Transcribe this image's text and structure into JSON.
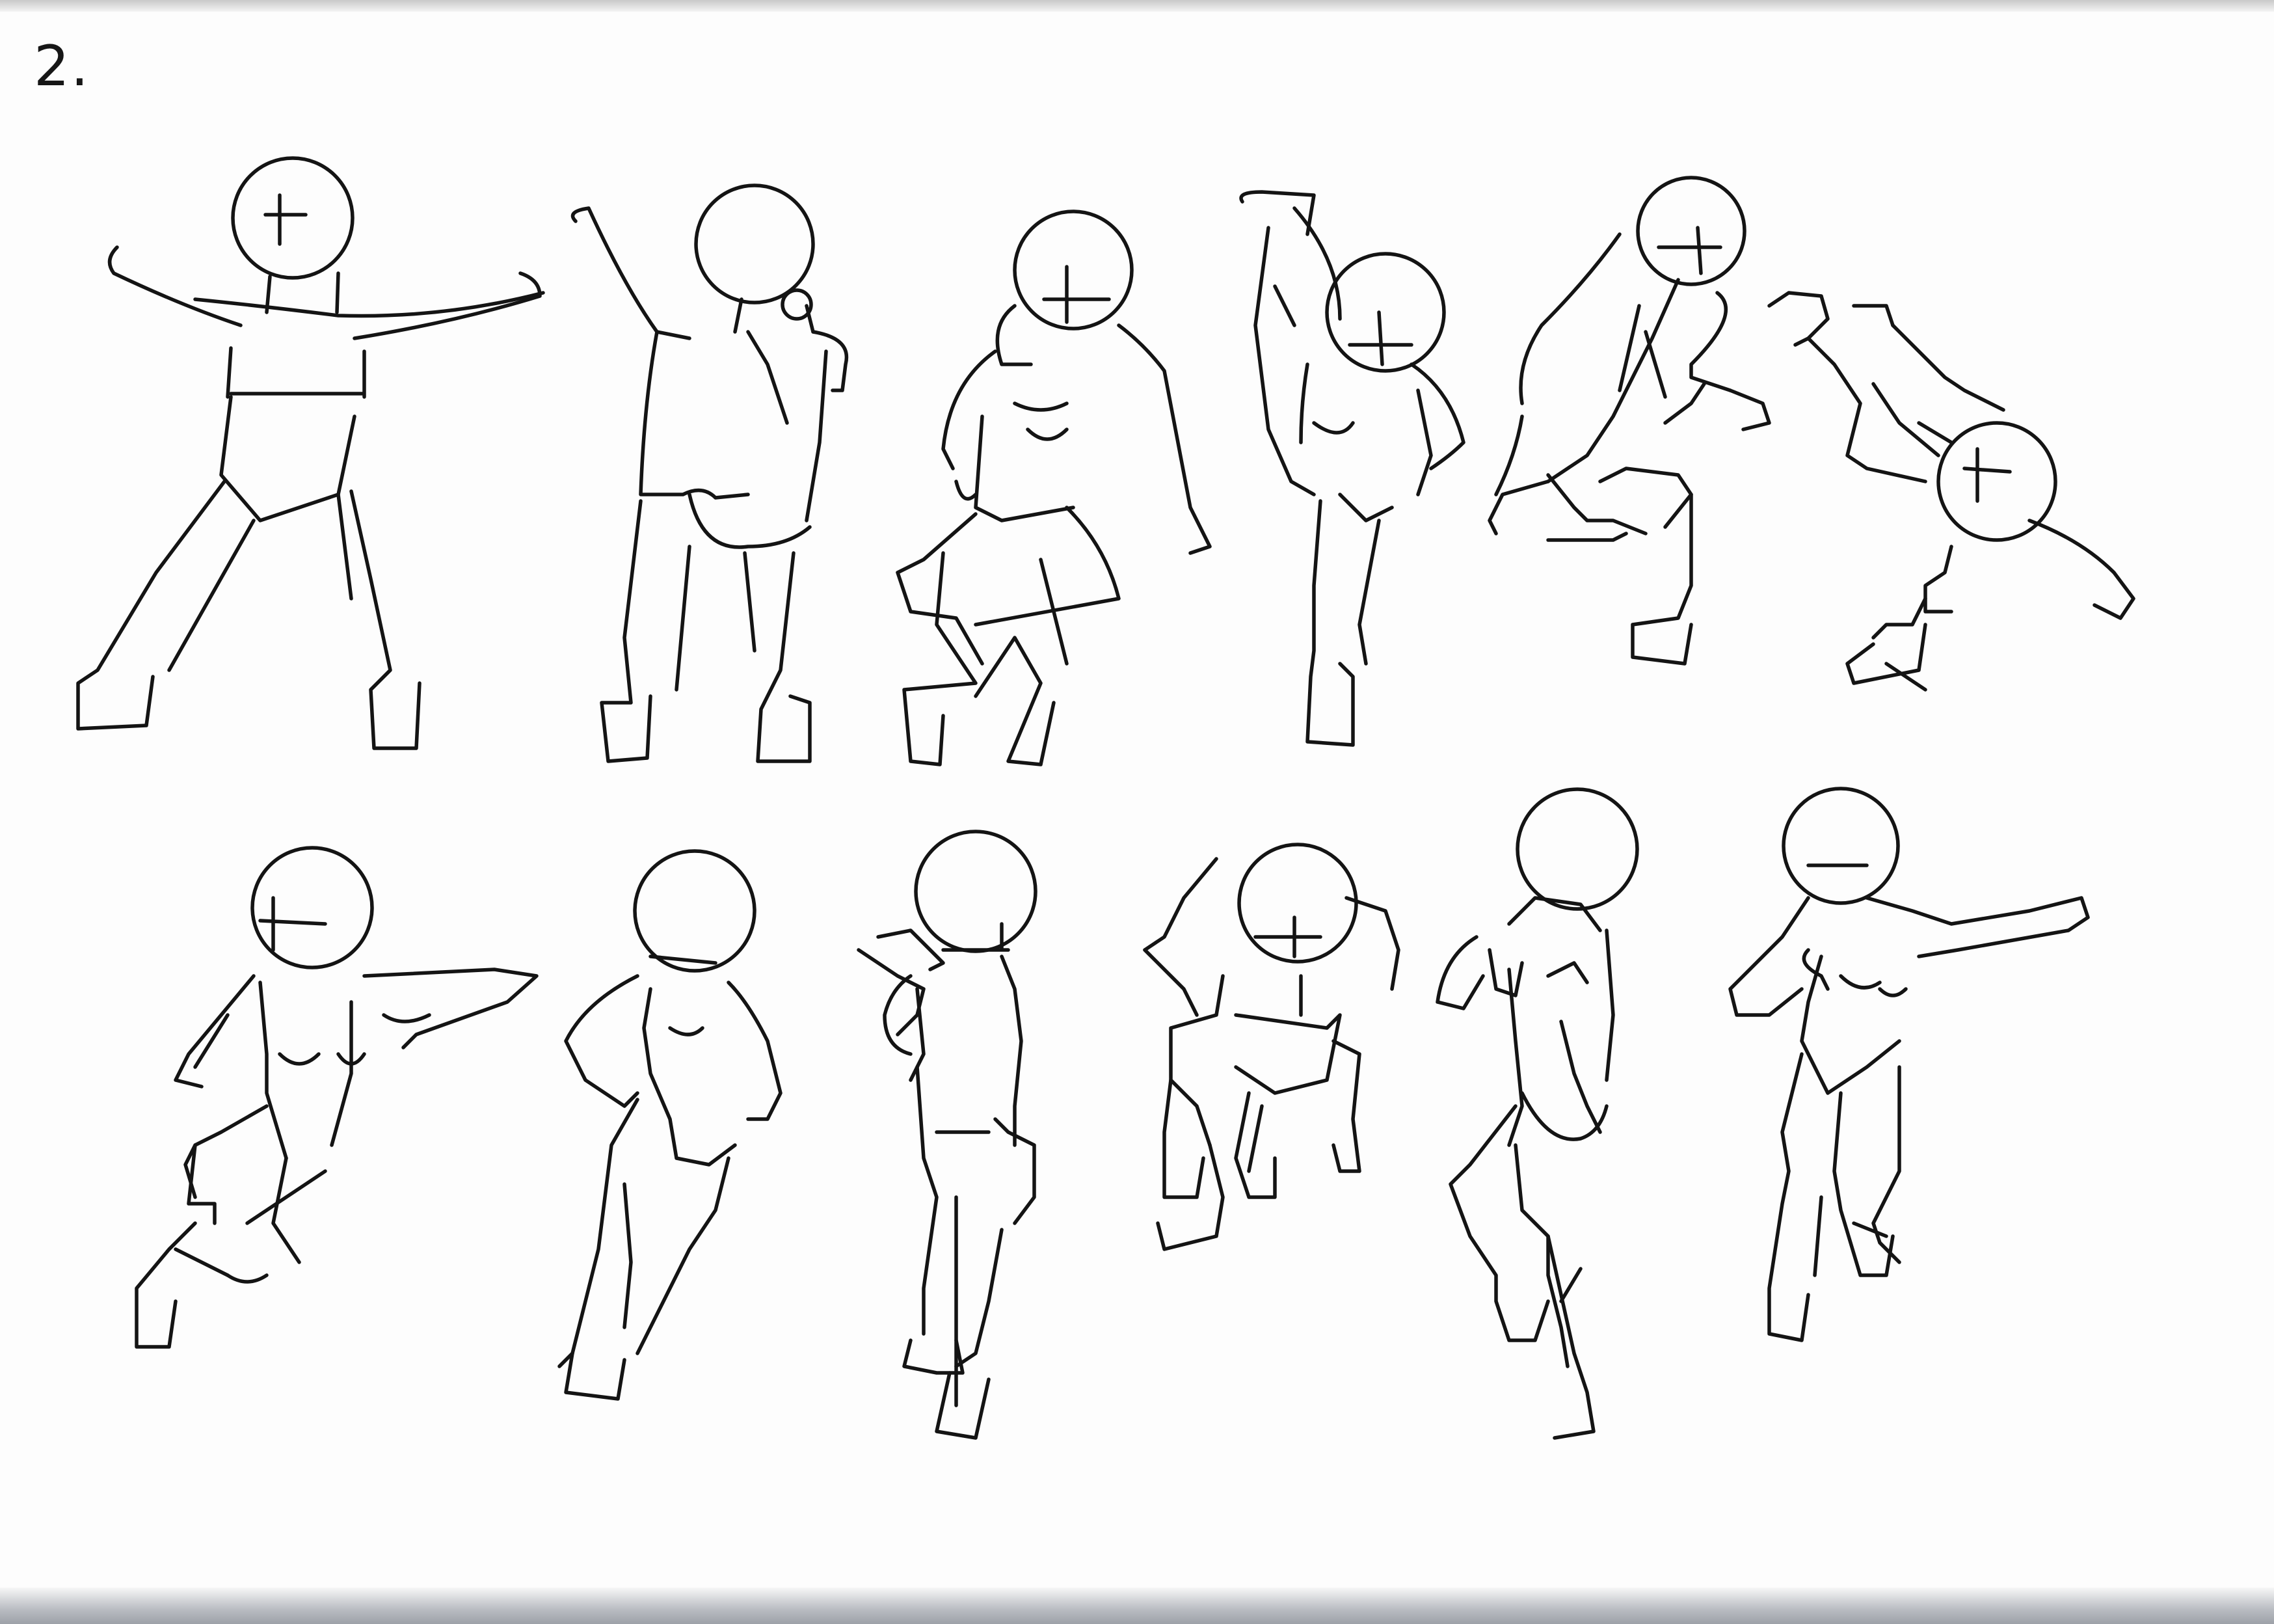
{
  "sheet": {
    "page_number": "2.",
    "row_count": 2,
    "figures_per_row": 6,
    "figures": [
      {
        "row": 1,
        "index": 1,
        "pose": "star-jump-arms-raised"
      },
      {
        "row": 1,
        "index": 2,
        "pose": "back-view-arm-raised"
      },
      {
        "row": 1,
        "index": 3,
        "pose": "seated-leaning"
      },
      {
        "row": 1,
        "index": 4,
        "pose": "high-kick"
      },
      {
        "row": 1,
        "index": 5,
        "pose": "crouching-lunge"
      },
      {
        "row": 1,
        "index": 6,
        "pose": "upside-down-roll"
      },
      {
        "row": 2,
        "index": 1,
        "pose": "kneeling-arm-extended"
      },
      {
        "row": 2,
        "index": 2,
        "pose": "hands-on-hips-striding"
      },
      {
        "row": 2,
        "index": 3,
        "pose": "back-view-arms-crossed"
      },
      {
        "row": 2,
        "index": 4,
        "pose": "crouching-forward"
      },
      {
        "row": 2,
        "index": 5,
        "pose": "back-view-hand-to-face"
      },
      {
        "row": 2,
        "index": 6,
        "pose": "standing-pointing"
      }
    ]
  },
  "colors": {
    "paper": "#fdfdfd",
    "ink": "#141414",
    "scan_edge": "#9da1a8"
  }
}
